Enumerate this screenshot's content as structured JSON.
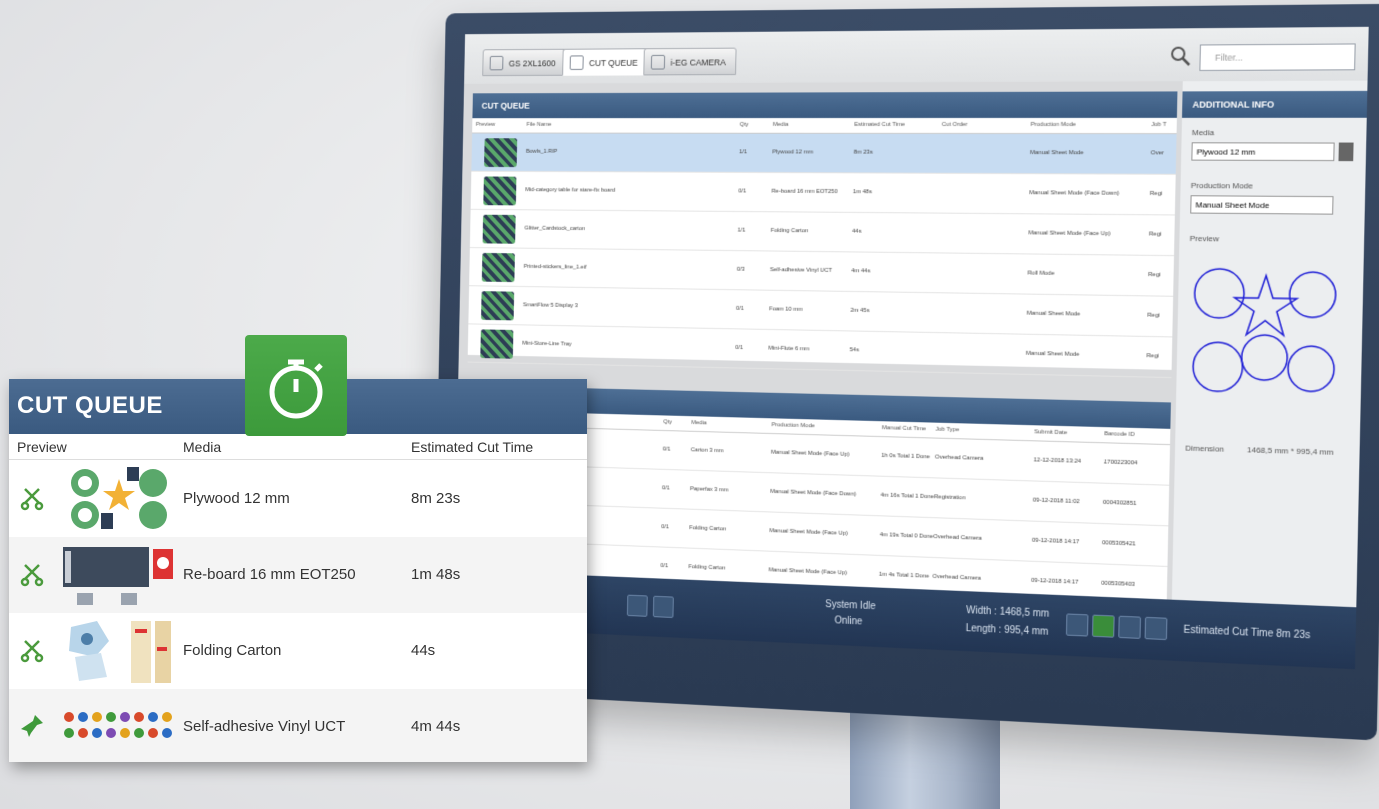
{
  "monitor": {
    "tabs": [
      {
        "label": "GS 2XL1600"
      },
      {
        "label": "CUT QUEUE"
      },
      {
        "label": "i-EG CAMERA"
      }
    ],
    "search": {
      "placeholder": "Filter..."
    },
    "cut_queue_title": "CUT QUEUE",
    "queue_headers": [
      "Preview",
      "File Name",
      "Qty",
      "Media",
      "Estimated Cut Time",
      "Cut Order",
      "Production Mode",
      "Job T"
    ],
    "queue_rows": [
      {
        "file": "Bowls_1.RIP",
        "qty": "1/1",
        "media": "Plywood 12 mm",
        "time": "8m 23s",
        "mode": "Manual Sheet Mode",
        "job": "Over"
      },
      {
        "file": "Mid-category table for stare-fix board",
        "qty": "0/1",
        "media": "Re-board 16 mm EOT250",
        "time": "1m 48s",
        "mode": "Manual Sheet Mode (Face Down)",
        "job": "Regi"
      },
      {
        "file": "Glitter_Cardstock_carton",
        "qty": "1/1",
        "media": "Folding Carton",
        "time": "44s",
        "mode": "Manual Sheet Mode (Face Up)",
        "job": "Regi"
      },
      {
        "file": "Printed-stickers_line_1.eif",
        "qty": "0/3",
        "media": "Self-adhesive Vinyl UCT",
        "time": "4m 44s",
        "mode": "Roll Mode",
        "job": "Regi"
      },
      {
        "file": "SmartFlow 5 Display 3",
        "qty": "0/1",
        "media": "Foam 10 mm",
        "time": "2m 45s",
        "mode": "Manual Sheet Mode",
        "job": "Regi"
      },
      {
        "file": "Mini-Store-Line Tray",
        "qty": "0/1",
        "media": "Mini-Flute 6 mm",
        "time": "54s",
        "mode": "Manual Sheet Mode",
        "job": "Regi"
      }
    ],
    "history_headers": [
      "Qty",
      "Media",
      "Production Mode",
      "Manual Cut Time",
      "Job Type",
      "Submit Date",
      "Barcode ID"
    ],
    "history_rows": [
      {
        "qty": "0/1",
        "media": "Carton 3 mm",
        "mode": "Manual Sheet Mode (Face Up)",
        "cut": "1h 0s Total 1 Done",
        "job": "Overhead Camera",
        "date": "12-12-2018 13:24",
        "barcode": "1700223004"
      },
      {
        "qty": "0/1",
        "media": "Paperfax 3 mm",
        "mode": "Manual Sheet Mode (Face Down)",
        "cut": "4m 16s Total 1 Done",
        "job": "Registration",
        "date": "09-12-2018 11:02",
        "barcode": "0004302851"
      },
      {
        "qty": "0/1",
        "media": "Folding Carton",
        "mode": "Manual Sheet Mode (Face Up)",
        "cut": "4m 19s Total 0 Done",
        "job": "Overhead Camera",
        "date": "09-12-2018 14:17",
        "barcode": "0005305421"
      },
      {
        "qty": "0/1",
        "media": "Folding Carton",
        "mode": "Manual Sheet Mode (Face Up)",
        "cut": "1m 4s Total 1 Done",
        "job": "Overhead Camera",
        "date": "09-12-2018 14:17",
        "barcode": "0005305403"
      }
    ],
    "additional_info": {
      "title": "ADDITIONAL INFO",
      "media_label": "Media",
      "media_value": "Plywood 12 mm",
      "production_label": "Production Mode",
      "production_value": "Manual Sheet Mode",
      "preview_label": "Preview",
      "dimension_label": "Dimension",
      "dimension_value": "1468,5 mm * 995,4 mm"
    },
    "status": {
      "line1": "System Idle",
      "line2": "Online",
      "width": "Width : 1468,5 mm",
      "length": "Length : 995,4 mm",
      "estimated": "Estimated Cut Time 8m 23s"
    }
  },
  "callout": {
    "title": "CUT QUEUE",
    "headers": {
      "preview": "Preview",
      "media": "Media",
      "time": "Estimated Cut Time"
    },
    "rows": [
      {
        "media": "Plywood 12 mm",
        "time": "8m 23s",
        "icon": "scissors-icon"
      },
      {
        "media": "Re-board 16 mm EOT250",
        "time": "1m 48s",
        "icon": "scissors-icon"
      },
      {
        "media": "Folding Carton",
        "time": "44s",
        "icon": "scissors-icon"
      },
      {
        "media": "Self-adhesive Vinyl UCT",
        "time": "4m 44s",
        "icon": "pin-icon"
      }
    ]
  },
  "colors": {
    "header_blue": "#3a5a80",
    "accent_green": "#3c9a3b",
    "selected_row": "#c7dcf2"
  }
}
